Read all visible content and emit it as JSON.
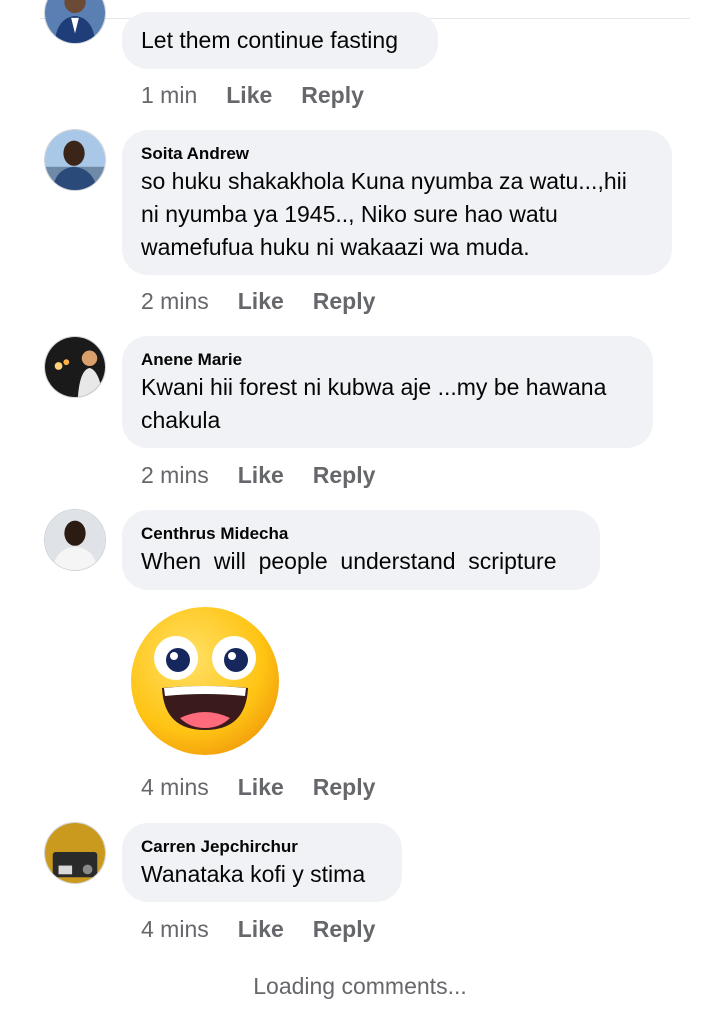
{
  "comments": [
    {
      "author": "",
      "text": "Let them continue fasting",
      "time": "1 min",
      "like_label": "Like",
      "reply_label": "Reply"
    },
    {
      "author": "Soita Andrew",
      "text": "so huku shakakhola Kuna nyumba za watu...,hii\nni nyumba ya 1945.., Niko sure hao watu\nwamefufua huku ni wakaazi wa muda.",
      "time": "2 mins",
      "like_label": "Like",
      "reply_label": "Reply"
    },
    {
      "author": "Anene Marie",
      "text": "Kwani hii forest ni kubwa aje ...my be hawana\nchakula",
      "time": "2 mins",
      "like_label": "Like",
      "reply_label": "Reply"
    },
    {
      "author": "Centhrus Midecha",
      "text": "When  will  people  understand  scripture",
      "time": "4 mins",
      "like_label": "Like",
      "reply_label": "Reply",
      "sticker_icon": "grinning-face-sticker"
    },
    {
      "author": "Carren Jepchirchur",
      "text": "Wanataka kofi y stima",
      "time": "4 mins",
      "like_label": "Like",
      "reply_label": "Reply"
    }
  ],
  "loading_text": "Loading comments...",
  "colors": {
    "bubble": "#f0f2f5",
    "meta_text": "#65676b",
    "text": "#050505",
    "sticker_yellow": "#ffc414"
  }
}
